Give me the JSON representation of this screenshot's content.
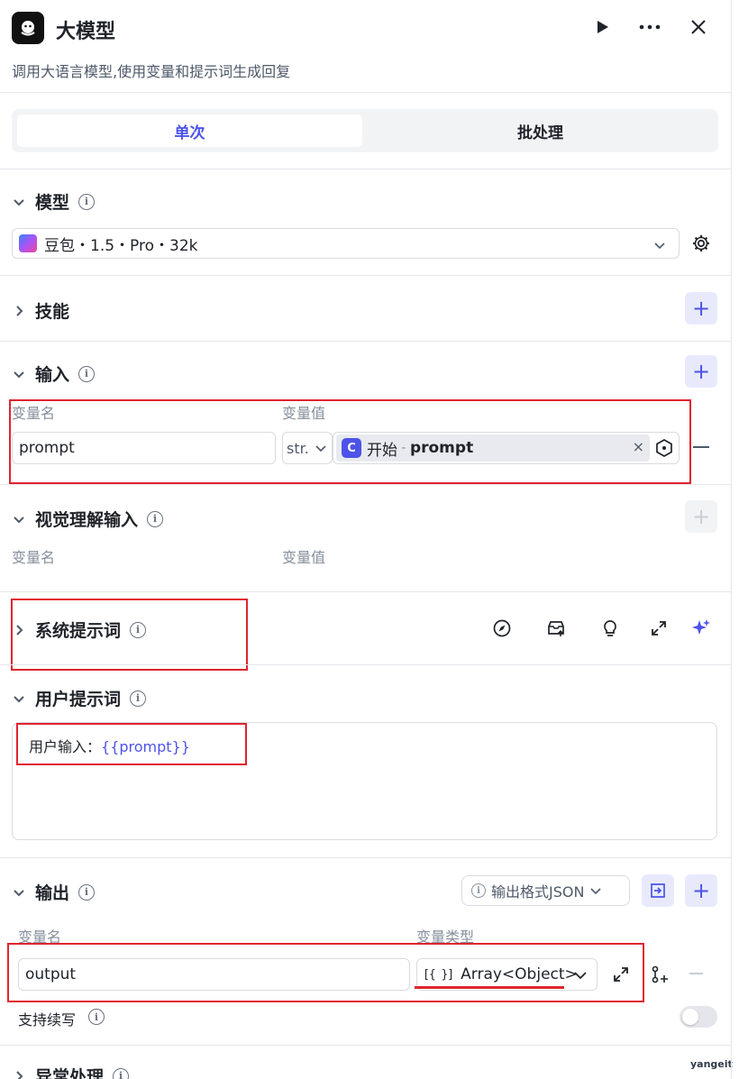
{
  "header": {
    "title": "大模型",
    "description": "调用大语言模型,使用变量和提示词生成回复"
  },
  "mode_tabs": {
    "single": "单次",
    "batch": "批处理"
  },
  "model_section": {
    "title": "模型",
    "selected_model": "豆包・1.5・Pro・32k"
  },
  "skills_section": {
    "title": "技能"
  },
  "input_section": {
    "title": "输入",
    "col_name": "变量名",
    "col_value": "变量值",
    "row": {
      "name": "prompt",
      "type": "str.",
      "ref_source": "开始",
      "ref_sep": " - ",
      "ref_var": "prompt"
    }
  },
  "visual_input_section": {
    "title": "视觉理解输入",
    "col_name": "变量名",
    "col_value": "变量值"
  },
  "system_prompt_section": {
    "title": "系统提示词"
  },
  "user_prompt_section": {
    "title": "用户提示词",
    "text_prefix": "用户输入：",
    "text_var": "{{prompt}}"
  },
  "output_section": {
    "title": "输出",
    "format_label": "输出格式JSON",
    "col_name": "变量名",
    "col_type": "变量类型",
    "row": {
      "name": "output",
      "type_icon": "[{ }]",
      "type": "Array<Object>"
    },
    "streaming_label": "支持续写",
    "streaming_enabled": false
  },
  "exception_section": {
    "title": "异常处理"
  },
  "watermark": "yangeit",
  "colors": {
    "accent": "#4d53e8",
    "highlight_red": "#e0242e",
    "divider": "#e5e6eb"
  }
}
